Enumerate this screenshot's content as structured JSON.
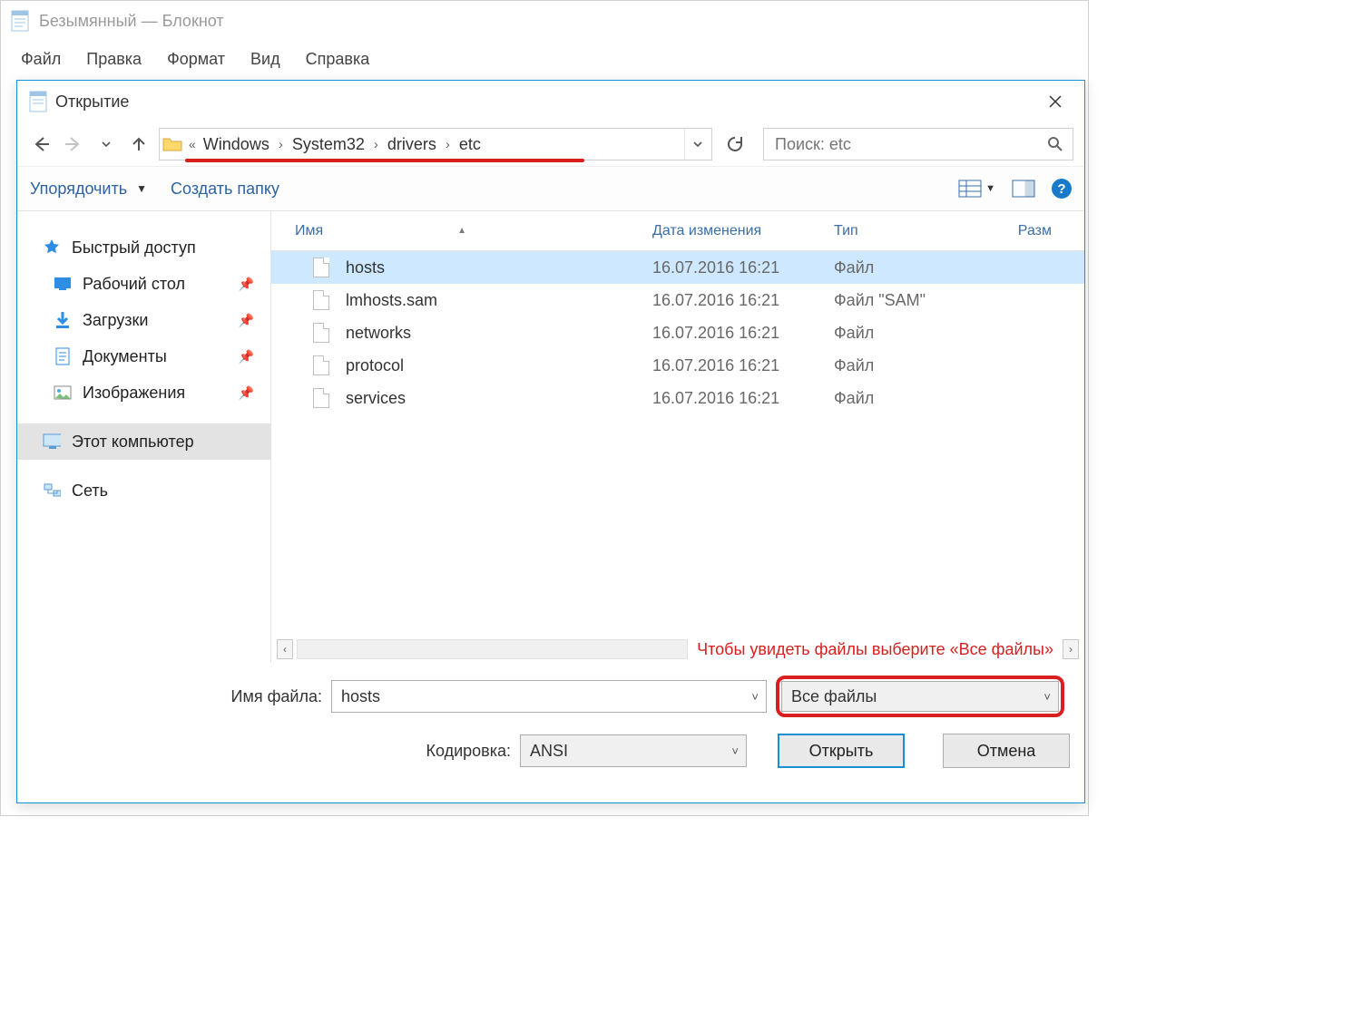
{
  "notepad": {
    "title": "Безымянный — Блокнот",
    "menu": [
      "Файл",
      "Правка",
      "Формат",
      "Вид",
      "Справка"
    ]
  },
  "dialog": {
    "title": "Открытие",
    "breadcrumb": {
      "overflow_glyph": "«",
      "items": [
        "Windows",
        "System32",
        "drivers",
        "etc"
      ]
    },
    "search_placeholder": "Поиск: etc",
    "toolbar": {
      "organize": "Упорядочить",
      "new_folder": "Создать папку"
    },
    "sidebar": {
      "quick_access": "Быстрый доступ",
      "items": [
        {
          "label": "Рабочий стол",
          "icon": "desktop"
        },
        {
          "label": "Загрузки",
          "icon": "downloads"
        },
        {
          "label": "Документы",
          "icon": "documents"
        },
        {
          "label": "Изображения",
          "icon": "pictures"
        }
      ],
      "this_pc": "Этот компьютер",
      "network": "Сеть"
    },
    "columns": {
      "name": "Имя",
      "date": "Дата изменения",
      "type": "Тип",
      "size": "Разм"
    },
    "files": [
      {
        "name": "hosts",
        "date": "16.07.2016 16:21",
        "type": "Файл",
        "selected": true
      },
      {
        "name": "lmhosts.sam",
        "date": "16.07.2016 16:21",
        "type": "Файл \"SAM\"",
        "selected": false
      },
      {
        "name": "networks",
        "date": "16.07.2016 16:21",
        "type": "Файл",
        "selected": false
      },
      {
        "name": "protocol",
        "date": "16.07.2016 16:21",
        "type": "Файл",
        "selected": false
      },
      {
        "name": "services",
        "date": "16.07.2016 16:21",
        "type": "Файл",
        "selected": false
      }
    ],
    "scroll_hint": "Чтобы увидеть файлы выберите «Все файлы»",
    "filename_label": "Имя файла:",
    "filename_value": "hosts",
    "filter_value": "Все файлы",
    "encoding_label": "Кодировка:",
    "encoding_value": "ANSI",
    "open_btn": "Открыть",
    "cancel_btn": "Отмена"
  }
}
